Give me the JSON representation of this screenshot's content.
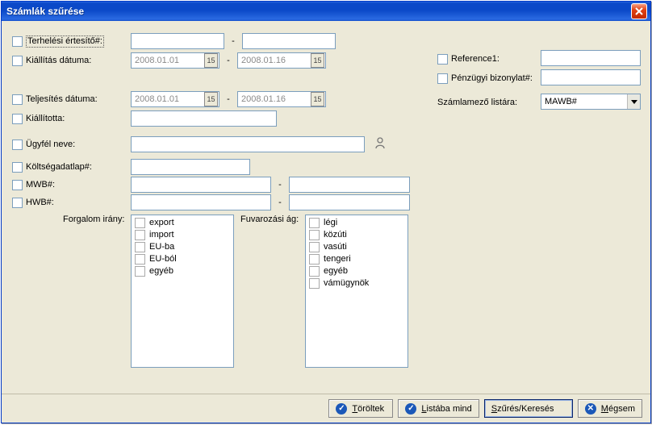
{
  "window": {
    "title": "Számlák szűrése"
  },
  "fields": {
    "terhelesi": "Terhelési értesítő#:",
    "kiallitas": "Kiállítás dátuma:",
    "teljesites": "Teljesítés dátuma:",
    "kiallitotta": "Kiállította:",
    "ugyfel": "Ügyfél neve:",
    "koltseg": "Költségadatlap#:",
    "mwb": "MWB#:",
    "hwb": "HWB#:",
    "forgalom": "Forgalom irány:",
    "fuvarozasi": "Fuvarozási ág:",
    "reference1": "Reference1:",
    "penzugyi": "Pénzügyi bizonylat#:",
    "szamlamezo": "Számlamező listára:"
  },
  "dates": {
    "kiallitas_from": "2008.01.01",
    "kiallitas_to": "2008.01.16",
    "teljesites_from": "2008.01.01",
    "teljesites_to": "2008.01.16"
  },
  "forgalom_options": [
    "export",
    "import",
    "EU-ba",
    "EU-ból",
    "egyéb"
  ],
  "fuvarozasi_options": [
    "légi",
    "közúti",
    "vasúti",
    "tengeri",
    "egyéb",
    "vámügynök"
  ],
  "combo": {
    "szamlamezo_value": "MAWB#"
  },
  "buttons": {
    "toroltek": "Töröltek",
    "listaba": "Listába mind",
    "szures": "Szűrés/Keresés",
    "megsem": "Mégsem"
  },
  "dash": "-",
  "dateglyph": "15"
}
